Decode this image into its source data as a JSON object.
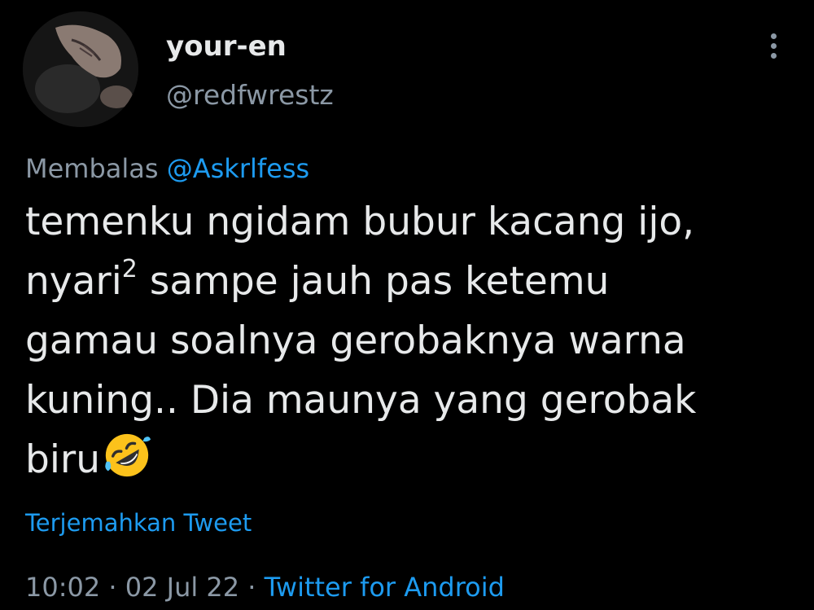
{
  "author": {
    "display_name": "your-en",
    "handle": "@redfwrestz"
  },
  "reply": {
    "prefix": "Membalas",
    "mention": "@Askrlfess"
  },
  "tweet": {
    "line1": "temenku ngidam bubur kacang ijo,",
    "line2_before": "nyari",
    "line2_sup": "2",
    "line2_after": " sampe jauh pas ketemu",
    "line3": "gamau soalnya gerobaknya warna",
    "line4": "kuning.. Dia maunya yang gerobak",
    "line5": "biru",
    "emoji": "rolling-on-the-floor-laughing"
  },
  "translate_label": "Terjemahkan Tweet",
  "meta": {
    "time": "10:02",
    "separator": " · ",
    "date": "02 Jul 22",
    "source": "Twitter for Android"
  },
  "colors": {
    "background": "#000000",
    "text": "#e7e9ea",
    "muted": "#8b98a5",
    "link": "#1d9bf0"
  }
}
